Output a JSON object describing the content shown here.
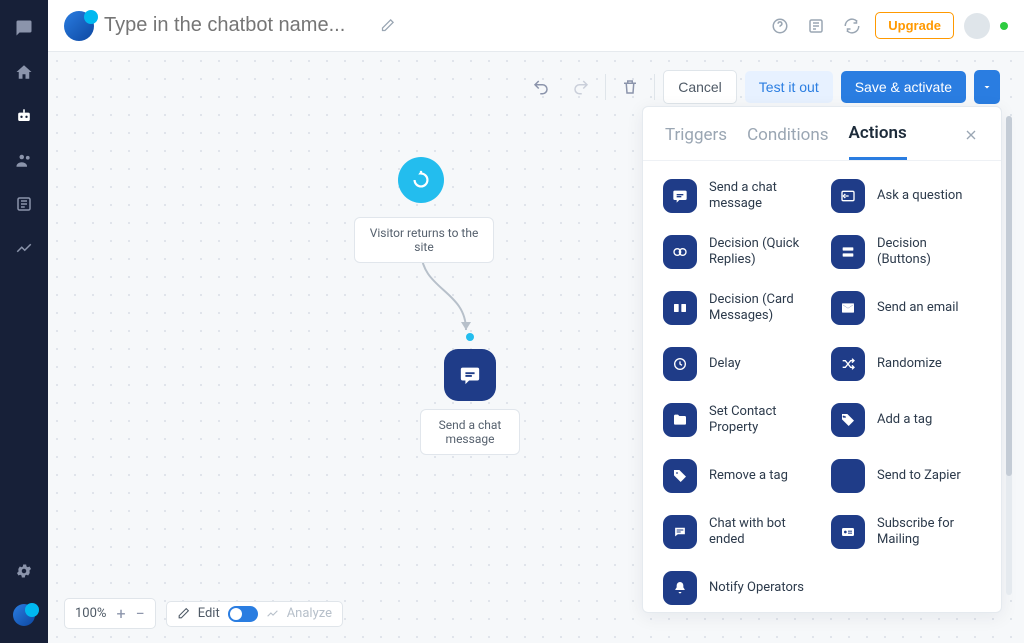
{
  "topbar": {
    "name_placeholder": "Type in the chatbot name...",
    "upgrade_label": "Upgrade"
  },
  "toolbar": {
    "cancel_label": "Cancel",
    "test_label": "Test it out",
    "save_label": "Save & activate"
  },
  "nodes": {
    "trigger_label": "Visitor returns to the site",
    "action_label": "Send a chat message"
  },
  "panel": {
    "tabs": {
      "t0": "Triggers",
      "t1": "Conditions",
      "t2": "Actions"
    },
    "actions": {
      "send_chat": "Send a chat message",
      "ask_question": "Ask a question",
      "decision_quick": "Decision (Quick Replies)",
      "decision_buttons": "Decision (Buttons)",
      "decision_card": "Decision (Card Messages)",
      "send_email": "Send an email",
      "delay": "Delay",
      "randomize": "Randomize",
      "set_contact": "Set Contact Property",
      "add_tag": "Add a tag",
      "remove_tag": "Remove a tag",
      "send_zapier": "Send to Zapier",
      "chat_ended": "Chat with bot ended",
      "subscribe_mail": "Subscribe for Mailing",
      "notify_ops": "Notify Operators"
    }
  },
  "bottombar": {
    "zoom": "100%",
    "edit": "Edit",
    "analyze": "Analyze"
  }
}
